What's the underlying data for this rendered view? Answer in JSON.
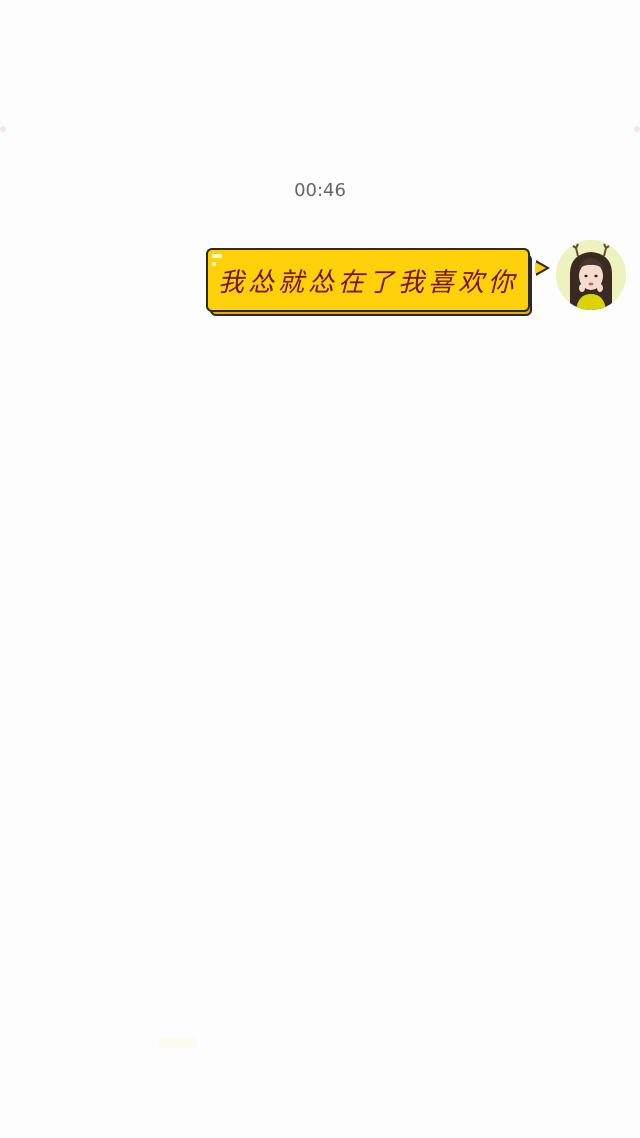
{
  "chat": {
    "timestamp": "00:46",
    "messages": [
      {
        "sender": "self",
        "text": "我怂就怂在了我喜欢你",
        "avatar_icon": "user-avatar"
      }
    ]
  },
  "colors": {
    "background": "#fdfdfd",
    "bubble_fill": "#fed10a",
    "bubble_shadow": "#f5a800",
    "bubble_border": "#2a2a2a",
    "bubble_text": "#7a1414",
    "timestamp_text": "#666666"
  }
}
